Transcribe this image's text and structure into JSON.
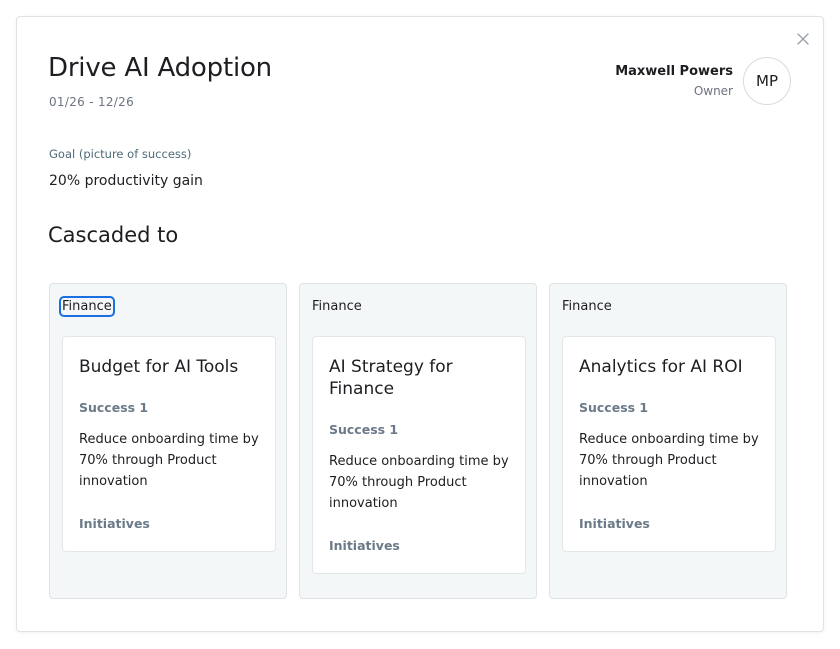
{
  "modal": {
    "title": "Drive AI Adoption",
    "dates": "01/26 - 12/26",
    "close_icon": "close-icon"
  },
  "owner": {
    "name": "Maxwell Powers",
    "role": "Owner",
    "initials": "MP"
  },
  "goal": {
    "label": "Goal (picture of success)",
    "value": "20% productivity gain"
  },
  "cascade": {
    "title": "Cascaded to",
    "cards": [
      {
        "department": "Finance",
        "title": "Budget for AI Tools",
        "success_label": "Success 1",
        "success_text": "Reduce onboarding time by 70% through Product innovation",
        "initiatives_label": "Initiatives"
      },
      {
        "department": "Finance",
        "title": "AI Strategy for Finance",
        "success_label": "Success 1",
        "success_text": "Reduce onboarding time by 70% through Product innovation",
        "initiatives_label": "Initiatives"
      },
      {
        "department": "Finance",
        "title": "Analytics for AI ROI",
        "success_label": "Success 1",
        "success_text": "Reduce onboarding time by 70% through Product innovation",
        "initiatives_label": "Initiatives"
      }
    ]
  },
  "colors": {
    "focus_outline": "#1b6fe0",
    "card_background": "#f4f7f8",
    "muted_label": "#6b7a88"
  }
}
